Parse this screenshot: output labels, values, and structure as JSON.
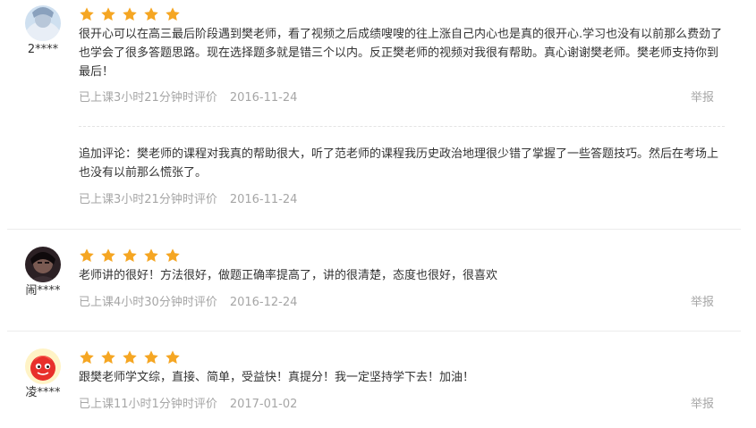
{
  "reviews": [
    {
      "user": "2****",
      "rating": 5,
      "content": "很开心可以在高三最后阶段遇到樊老师，看了视频之后成绩嗖嗖的往上涨自己内心也是真的很开心.学习也没有以前那么费劲了也学会了很多答题思路。现在选择题多就是错三个以内。反正樊老师的视频对我很有帮助。真心谢谢樊老师。樊老师支持你到最后！",
      "study_time": "已上课3小时21分钟时评价",
      "date": "2016-11-24",
      "report_label": "举报",
      "addition": {
        "content": "追加评论：樊老师的课程对我真的帮助很大，听了范老师的课程我历史政治地理很少错了掌握了一些答题技巧。然后在考场上也没有以前那么慌张了。",
        "study_time": "已上课3小时21分钟时评价",
        "date": "2016-11-24"
      }
    },
    {
      "user": "闹****",
      "rating": 5,
      "content": "老师讲的很好！方法很好，做题正确率提高了，讲的很清楚，态度也很好，很喜欢",
      "study_time": "已上课4小时30分钟时评价",
      "date": "2016-12-24",
      "report_label": "举报"
    },
    {
      "user": "凌****",
      "rating": 5,
      "content": "跟樊老师学文综，直接、简单，受益快！真提分！我一定坚持学下去！加油！",
      "study_time": "已上课11小时1分钟时评价",
      "date": "2017-01-02",
      "report_label": "举报"
    }
  ],
  "colors": {
    "star": "#f5a623",
    "meta": "#a6a6a6",
    "text": "#333333"
  },
  "icons": {
    "star": "star-icon"
  }
}
